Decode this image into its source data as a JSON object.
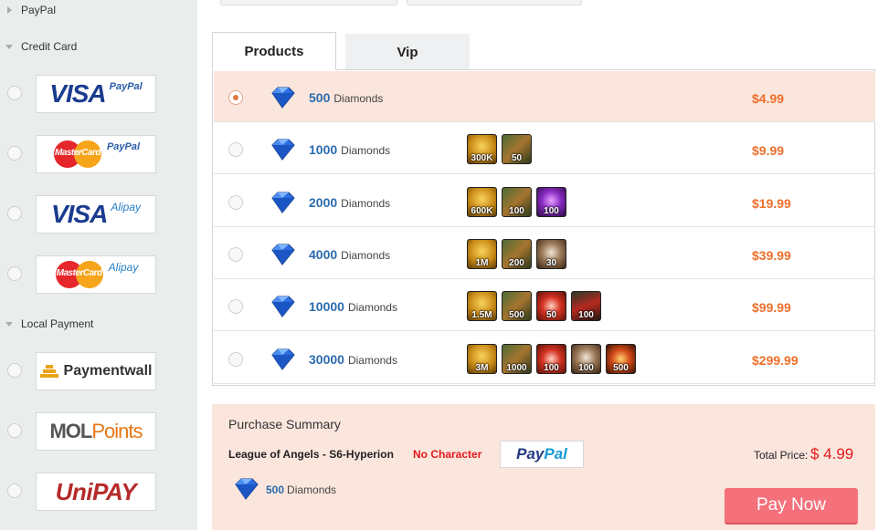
{
  "sidebar": {
    "paypal_group": "PayPal",
    "credit_card_group": "Credit Card",
    "local_payment_group": "Local Payment",
    "methods": [
      {
        "brand": "VISA",
        "partner": "PayPal"
      },
      {
        "brand": "MasterCard",
        "partner": "PayPal"
      },
      {
        "brand": "VISA",
        "partner": "Alipay"
      },
      {
        "brand": "MasterCard",
        "partner": "Alipay"
      },
      {
        "brand": "Paymentwall"
      },
      {
        "brand": "MOL",
        "partner": "Points"
      },
      {
        "brand": "UniPAY"
      }
    ]
  },
  "tabs": {
    "products": "Products",
    "vip": "Vip"
  },
  "products": [
    {
      "amount": "500",
      "unit": "Diamonds",
      "price": "$4.99",
      "selected": true,
      "items": []
    },
    {
      "amount": "1000",
      "unit": "Diamonds",
      "price": "$9.99",
      "selected": false,
      "items": [
        {
          "icon": "gold-coins-icon",
          "qty": "300K"
        },
        {
          "icon": "book-icon",
          "qty": "50"
        }
      ]
    },
    {
      "amount": "2000",
      "unit": "Diamonds",
      "price": "$19.99",
      "selected": false,
      "items": [
        {
          "icon": "gold-coins-icon",
          "qty": "600K"
        },
        {
          "icon": "book-icon",
          "qty": "100"
        },
        {
          "icon": "purple-orb-icon",
          "qty": "100"
        }
      ]
    },
    {
      "amount": "4000",
      "unit": "Diamonds",
      "price": "$39.99",
      "selected": false,
      "items": [
        {
          "icon": "gold-coins-icon",
          "qty": "1M"
        },
        {
          "icon": "book-icon",
          "qty": "200"
        },
        {
          "icon": "pearl-icon",
          "qty": "30"
        }
      ]
    },
    {
      "amount": "10000",
      "unit": "Diamonds",
      "price": "$99.99",
      "selected": false,
      "items": [
        {
          "icon": "gold-coins-icon",
          "qty": "1.5M"
        },
        {
          "icon": "book-icon",
          "qty": "500"
        },
        {
          "icon": "red-star-icon",
          "qty": "50"
        },
        {
          "icon": "red-roof-icon",
          "qty": "100"
        }
      ]
    },
    {
      "amount": "30000",
      "unit": "Diamonds",
      "price": "$299.99",
      "selected": false,
      "items": [
        {
          "icon": "gold-coins-icon",
          "qty": "3M"
        },
        {
          "icon": "book-icon",
          "qty": "1000"
        },
        {
          "icon": "red-star-icon",
          "qty": "100"
        },
        {
          "icon": "pearl-icon",
          "qty": "100"
        },
        {
          "icon": "fire-orb-icon",
          "qty": "500"
        }
      ]
    }
  ],
  "summary": {
    "title": "Purchase Summary",
    "game": "League of Angels - S6-Hyperion",
    "character": "No Character",
    "method_pay": "Pay",
    "method_pal": "Pal",
    "total_label": "Total Price:",
    "total_value": "$ 4.99",
    "amount": "500",
    "unit": "Diamonds",
    "pay_button": "Pay Now"
  },
  "colors": {
    "accent_price": "#ee6f2a",
    "selected_row": "#fbe6dd",
    "pay_button": "#f4707a",
    "alert_red": "#e4181c",
    "link_blue": "#2c6bad"
  }
}
